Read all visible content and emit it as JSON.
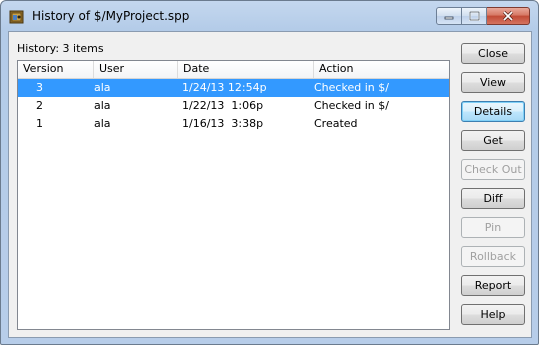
{
  "window": {
    "title": "History of $/MyProject.spp",
    "icon": "sourcesafe-app-icon",
    "caption_buttons": [
      "minimize",
      "maximize",
      "close"
    ]
  },
  "history_label": "History: 3 items",
  "columns": [
    "Version",
    "User",
    "Date",
    "Action"
  ],
  "rows": [
    {
      "version": "3",
      "user": "ala",
      "date": "1/24/13 12:54p",
      "action": "Checked in $/",
      "selected": true
    },
    {
      "version": "2",
      "user": "ala",
      "date": "1/22/13  1:06p",
      "action": "Checked in $/",
      "selected": false
    },
    {
      "version": "1",
      "user": "ala",
      "date": "1/16/13  3:38p",
      "action": "Created",
      "selected": false
    }
  ],
  "buttons": [
    {
      "label": "Close",
      "enabled": true,
      "default": false
    },
    {
      "label": "View",
      "enabled": true,
      "default": false
    },
    {
      "label": "Details",
      "enabled": true,
      "default": true
    },
    {
      "label": "Get",
      "enabled": true,
      "default": false
    },
    {
      "label": "Check Out",
      "enabled": false,
      "default": false
    },
    {
      "label": "Diff",
      "enabled": true,
      "default": false
    },
    {
      "label": "Pin",
      "enabled": false,
      "default": false
    },
    {
      "label": "Rollback",
      "enabled": false,
      "default": false
    },
    {
      "label": "Report",
      "enabled": true,
      "default": false
    },
    {
      "label": "Help",
      "enabled": true,
      "default": false
    }
  ],
  "colors": {
    "selection": "#3399ff",
    "close_button": "#c14a35"
  }
}
